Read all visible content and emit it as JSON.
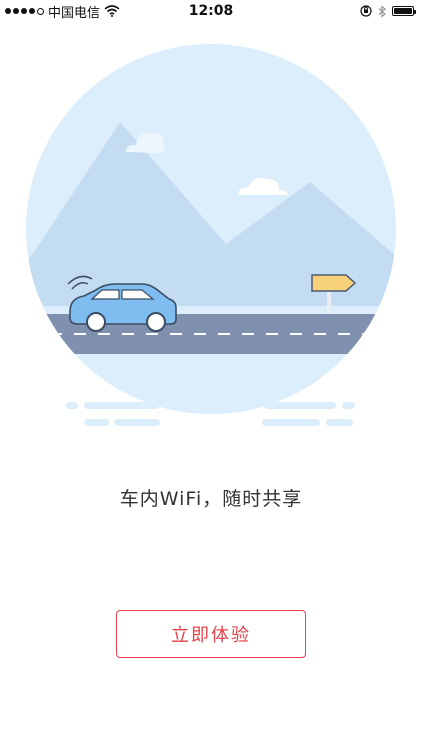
{
  "status_bar": {
    "carrier": "中国电信",
    "time": "12:08",
    "signal_bars_filled": 4,
    "signal_bars_total": 5,
    "icons": [
      "signal-icon",
      "wifi-icon",
      "orientation-lock-icon",
      "bluetooth-icon",
      "battery-icon"
    ]
  },
  "illustration": {
    "description_icons": [
      "mountain-icon",
      "cloud-icon",
      "car-icon",
      "road-icon",
      "signpost-icon"
    ],
    "colors": {
      "sky": "#dcedfb",
      "mountain": "#c4dcf2",
      "road": "#7f91ae",
      "car": "#7fbdf0",
      "sign": "#f7d27a"
    }
  },
  "main": {
    "tagline": "车内WiFi，随时共享",
    "cta_label": "立即体验"
  },
  "colors": {
    "accent": "#e8424a"
  }
}
